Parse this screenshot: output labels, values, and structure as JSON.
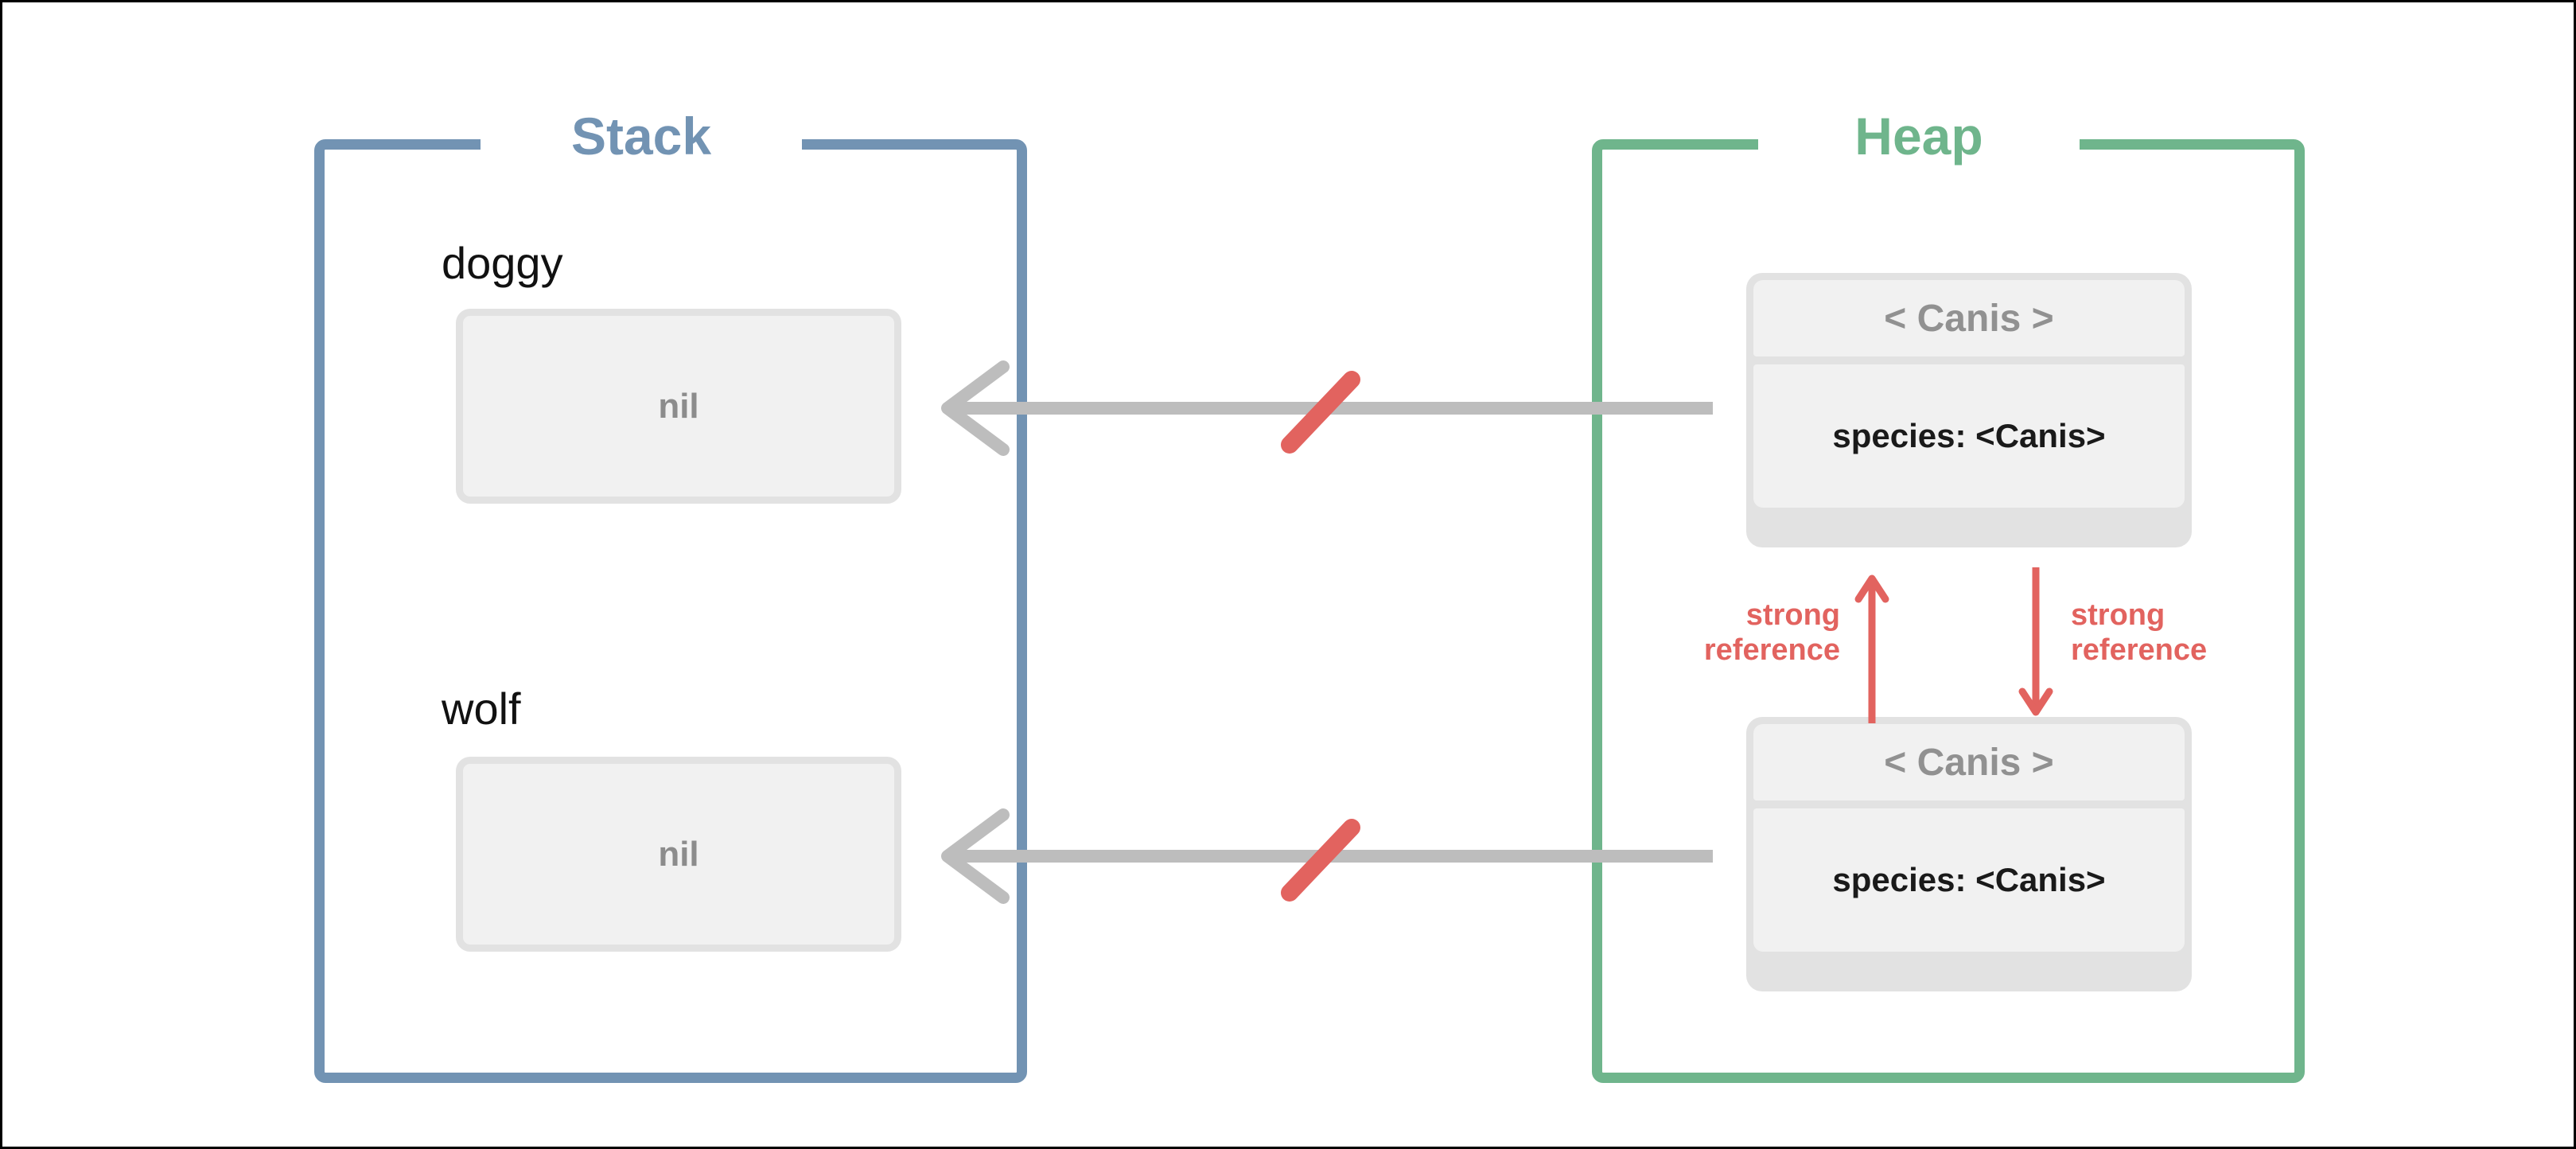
{
  "diagram": {
    "title_stack": "Stack",
    "title_heap": "Heap",
    "colors": {
      "stack_border": "#7293b3",
      "heap_border": "#6fb58c",
      "strong_reference": "#e2635f",
      "broken_link_slash": "#e2635f",
      "arrow_line": "#bdbdbd",
      "box_fill": "#f1f1f1",
      "box_border": "#e2e2e2",
      "nil_text": "#8c8c8c",
      "class_name_text": "#919191",
      "property_text": "#1a1a1a",
      "page_border": "#000000"
    }
  },
  "stack": {
    "label": "Stack",
    "variables": [
      {
        "name": "doggy",
        "value": "nil"
      },
      {
        "name": "wolf",
        "value": "nil"
      }
    ]
  },
  "heap": {
    "label": "Heap",
    "objects": [
      {
        "class_name": "< Canis >",
        "property": "species: <Canis>"
      },
      {
        "class_name": "< Canis >",
        "property": "species: <Canis>"
      }
    ]
  },
  "references": {
    "heap_to_stack": [
      {
        "from": "heap-object-1",
        "to": "stack-variable-doggy",
        "broken": true,
        "marker": "slash"
      },
      {
        "from": "heap-object-2",
        "to": "stack-variable-wolf",
        "broken": true,
        "marker": "slash"
      }
    ],
    "heap_to_heap": [
      {
        "label_line1": "strong",
        "label_line2": "reference",
        "direction": "up",
        "from": "heap-object-2",
        "to": "heap-object-1"
      },
      {
        "label_line1": "strong",
        "label_line2": "reference",
        "direction": "down",
        "from": "heap-object-1",
        "to": "heap-object-2"
      }
    ]
  }
}
